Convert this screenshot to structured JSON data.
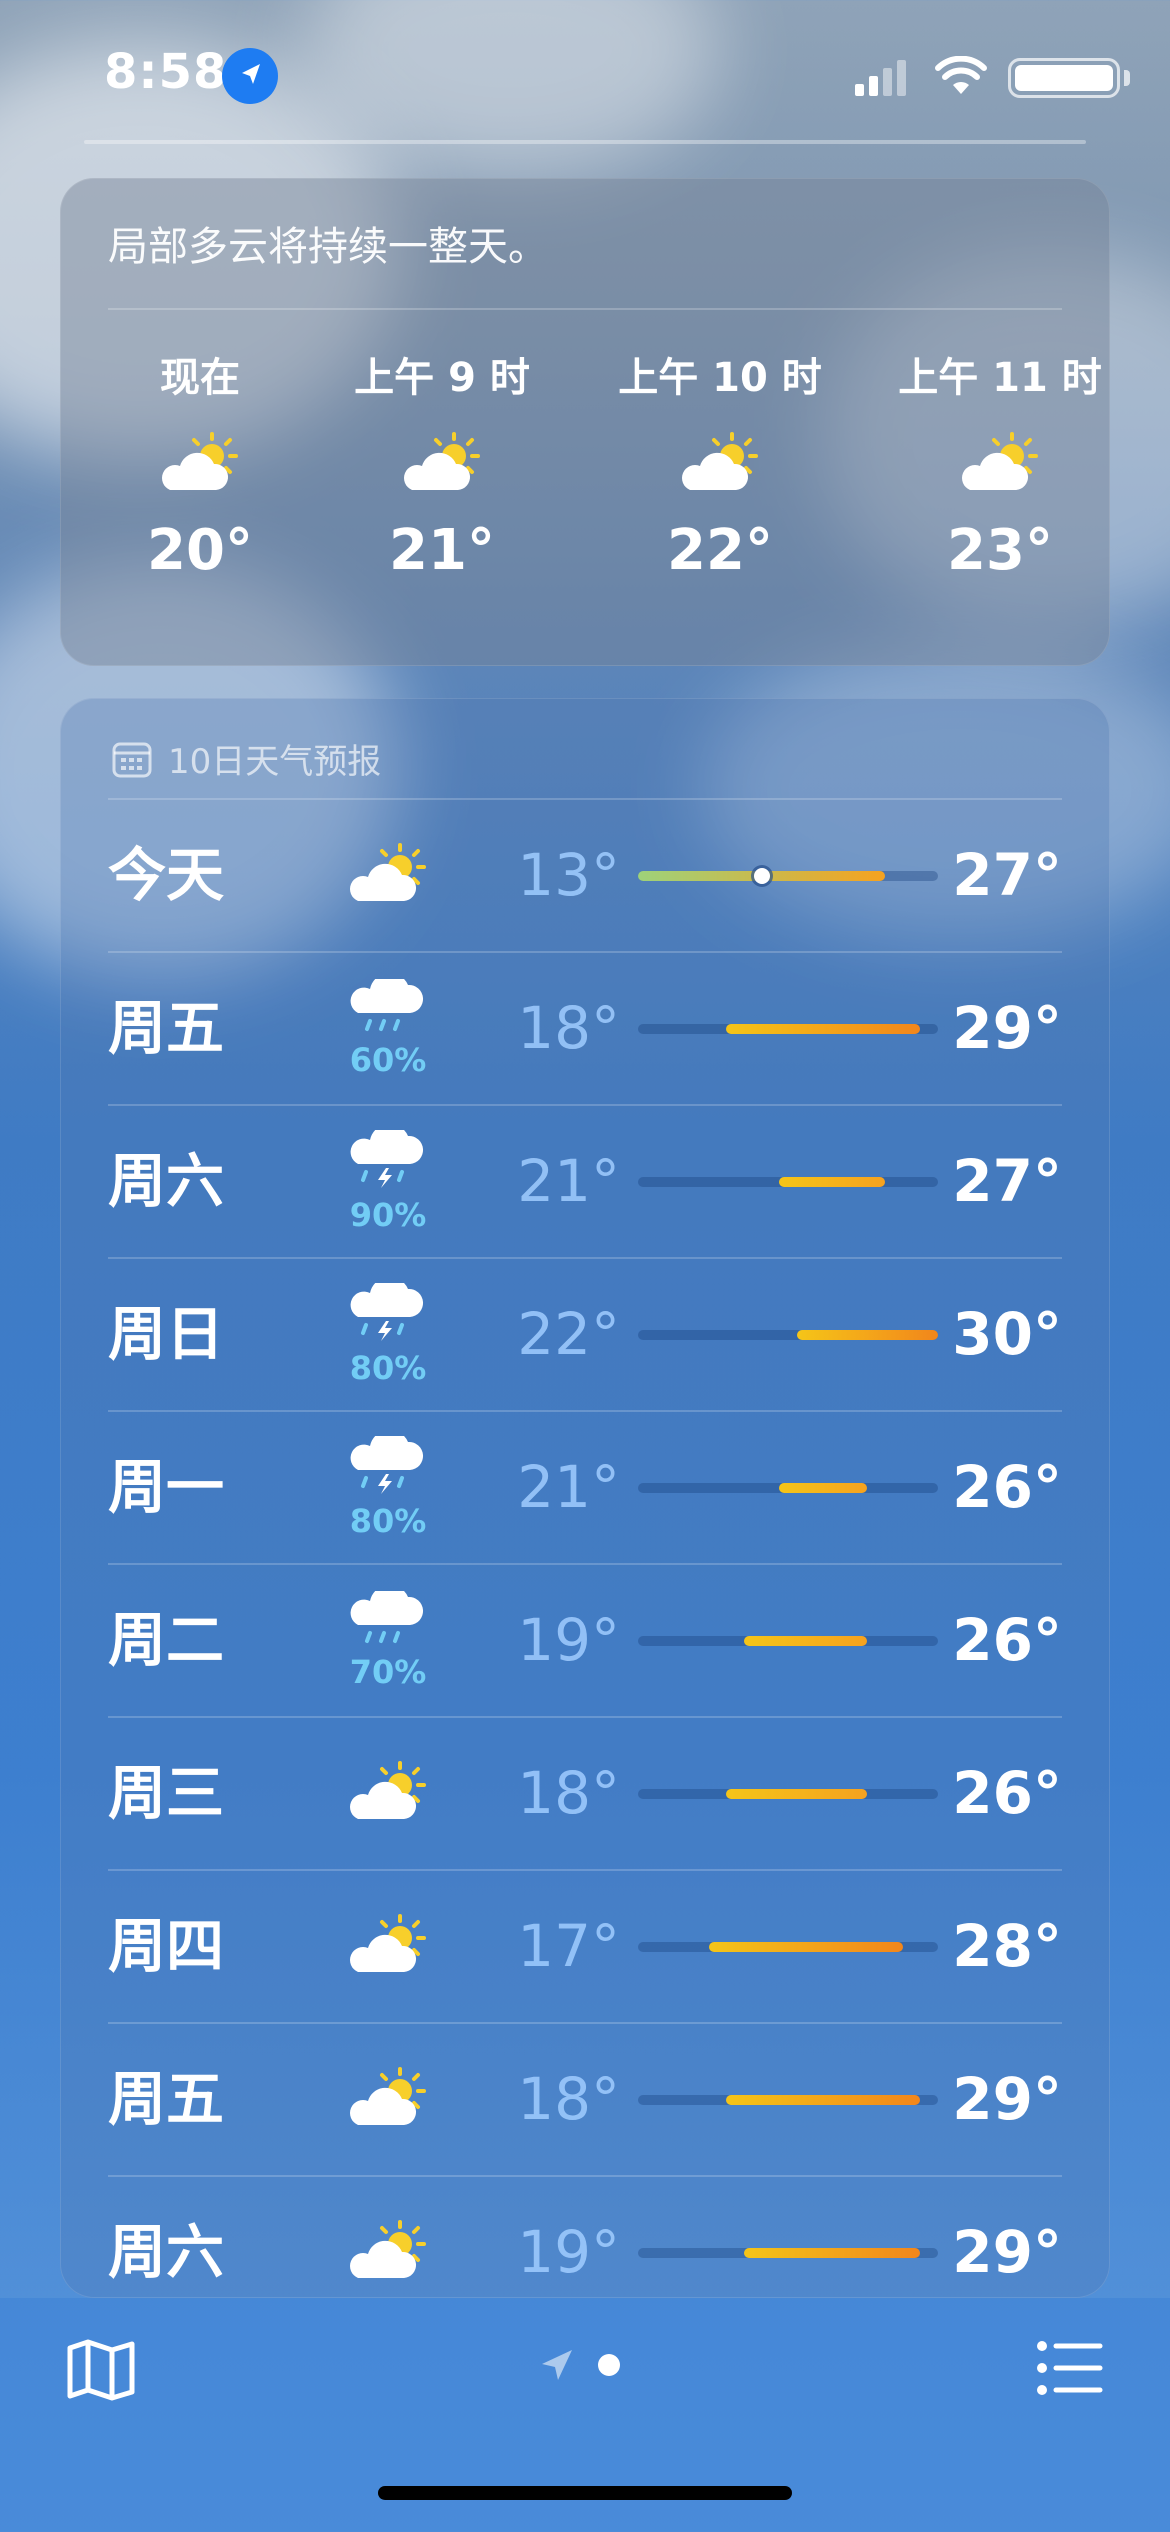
{
  "status": {
    "time": "8:58"
  },
  "hourly": {
    "summary": "局部多云将持续一整天。",
    "items": [
      {
        "label": "现在",
        "temp": "20°",
        "icon": "partly-sunny-icon"
      },
      {
        "label": "上午 9 时",
        "temp": "21°",
        "icon": "partly-sunny-icon"
      },
      {
        "label": "上午 10 时",
        "temp": "22°",
        "icon": "partly-sunny-icon"
      },
      {
        "label": "上午 11 时",
        "temp": "23°",
        "icon": "partly-sunny-icon"
      }
    ]
  },
  "forecast": {
    "title": "10日天气预报",
    "range_min": 13,
    "range_max": 30,
    "days": [
      {
        "day": "今天",
        "icon": "partly-sunny-icon",
        "precip": "",
        "low": "13°",
        "high": "27°",
        "low_v": 13,
        "high_v": 27,
        "current_v": 20
      },
      {
        "day": "周五",
        "icon": "rain-cloud-icon",
        "precip": "60%",
        "low": "18°",
        "high": "29°",
        "low_v": 18,
        "high_v": 29
      },
      {
        "day": "周六",
        "icon": "thunderstorm-icon",
        "precip": "90%",
        "low": "21°",
        "high": "27°",
        "low_v": 21,
        "high_v": 27
      },
      {
        "day": "周日",
        "icon": "thunderstorm-icon",
        "precip": "80%",
        "low": "22°",
        "high": "30°",
        "low_v": 22,
        "high_v": 30
      },
      {
        "day": "周一",
        "icon": "thunderstorm-icon",
        "precip": "80%",
        "low": "21°",
        "high": "26°",
        "low_v": 21,
        "high_v": 26
      },
      {
        "day": "周二",
        "icon": "rain-cloud-icon",
        "precip": "70%",
        "low": "19°",
        "high": "26°",
        "low_v": 19,
        "high_v": 26
      },
      {
        "day": "周三",
        "icon": "partly-sunny-icon",
        "precip": "",
        "low": "18°",
        "high": "26°",
        "low_v": 18,
        "high_v": 26
      },
      {
        "day": "周四",
        "icon": "partly-sunny-icon",
        "precip": "",
        "low": "17°",
        "high": "28°",
        "low_v": 17,
        "high_v": 28
      },
      {
        "day": "周五",
        "icon": "partly-sunny-icon",
        "precip": "",
        "low": "18°",
        "high": "29°",
        "low_v": 18,
        "high_v": 29
      },
      {
        "day": "周六",
        "icon": "partly-sunny-icon",
        "precip": "",
        "low": "19°",
        "high": "29°",
        "low_v": 19,
        "high_v": 29
      }
    ]
  },
  "toolbar": {
    "pages": [
      "location-arrow-icon",
      "page-dot"
    ],
    "left_icon": "map-icon",
    "right_icon": "list-icon"
  }
}
